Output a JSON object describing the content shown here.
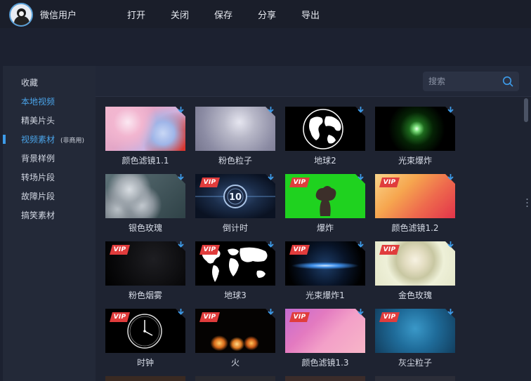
{
  "header": {
    "username": "微信用户",
    "menu": [
      "打开",
      "关闭",
      "保存",
      "分享",
      "导出"
    ]
  },
  "sidebar": {
    "items": [
      {
        "label": "收藏"
      },
      {
        "label": "本地视频"
      },
      {
        "label": "精美片头"
      },
      {
        "label": "视频素材",
        "sub": "(非商用)"
      },
      {
        "label": "背景样例"
      },
      {
        "label": "转场片段"
      },
      {
        "label": "故障片段"
      },
      {
        "label": "搞笑素材"
      }
    ],
    "active_index": 3
  },
  "search": {
    "placeholder": "搜索"
  },
  "badges": {
    "vip": "VIP"
  },
  "colors": {
    "accent": "#3d9be9",
    "vip": "#e03c3c"
  },
  "grid": {
    "items": [
      {
        "label": "颜色滤镜1.1",
        "vip": false,
        "thumb": "pink-bokeh"
      },
      {
        "label": "粉色粒子",
        "vip": false,
        "thumb": "silver-particles"
      },
      {
        "label": "地球2",
        "vip": false,
        "thumb": "globe-black"
      },
      {
        "label": "光束爆炸",
        "vip": false,
        "thumb": "green-flare"
      },
      {
        "label": "银色玫瑰",
        "vip": false,
        "thumb": "silver-roses"
      },
      {
        "label": "倒计时",
        "vip": true,
        "thumb": "countdown-10"
      },
      {
        "label": "爆炸",
        "vip": true,
        "thumb": "green-screen-explosion"
      },
      {
        "label": "颜色滤镜1.2",
        "vip": true,
        "thumb": "orange-gradient"
      },
      {
        "label": "粉色烟雾",
        "vip": true,
        "thumb": "dark-dust"
      },
      {
        "label": "地球3",
        "vip": true,
        "thumb": "world-map"
      },
      {
        "label": "光束爆炸1",
        "vip": true,
        "thumb": "blue-flare"
      },
      {
        "label": "金色玫瑰",
        "vip": true,
        "thumb": "white-rose"
      },
      {
        "label": "时钟",
        "vip": true,
        "thumb": "clock"
      },
      {
        "label": "火",
        "vip": true,
        "thumb": "fire"
      },
      {
        "label": "颜色滤镜1.3",
        "vip": true,
        "thumb": "purple-gradient"
      },
      {
        "label": "灰尘粒子",
        "vip": true,
        "thumb": "blue-particles"
      }
    ],
    "countdown_text": "10"
  }
}
